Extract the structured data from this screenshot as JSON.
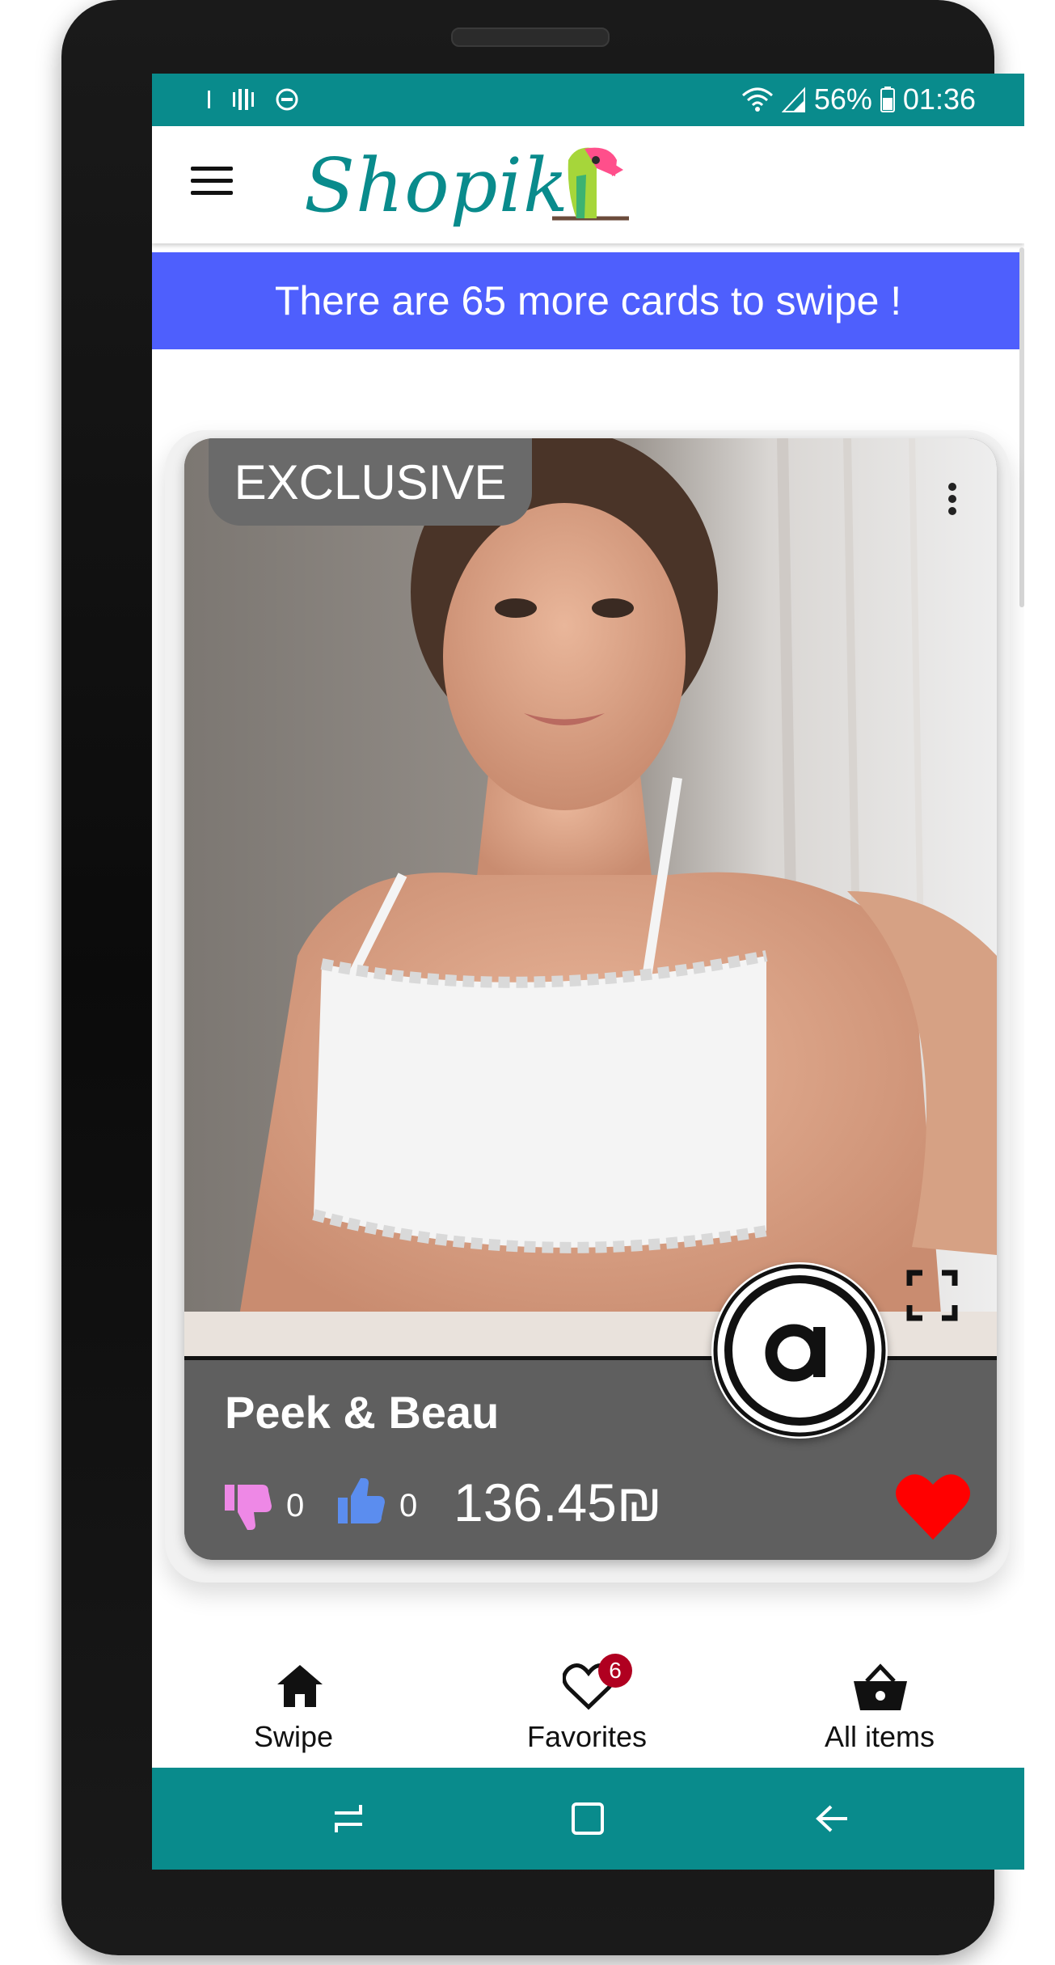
{
  "status_bar": {
    "battery": "56%",
    "time": "01:36"
  },
  "app": {
    "logo_text": "Shopik"
  },
  "banner": {
    "text": "There are 65 more cards to swipe !"
  },
  "card": {
    "badge": "EXCLUSIVE",
    "brand": "Peek & Beau",
    "dislikes": "0",
    "likes": "0",
    "price": "136.45₪",
    "favorited": true
  },
  "bottom_nav": {
    "items": [
      {
        "label": "Swipe",
        "icon": "home-icon"
      },
      {
        "label": "Favorites",
        "icon": "heart-outline-icon",
        "badge": "6"
      },
      {
        "label": "All items",
        "icon": "basket-icon"
      }
    ]
  },
  "colors": {
    "teal": "#098b8c",
    "banner_blue": "#4e5ffd",
    "dislike_pink": "#ee88e6",
    "like_blue": "#5b8def",
    "heart_red": "#ff0000",
    "badge_red": "#b00020"
  }
}
